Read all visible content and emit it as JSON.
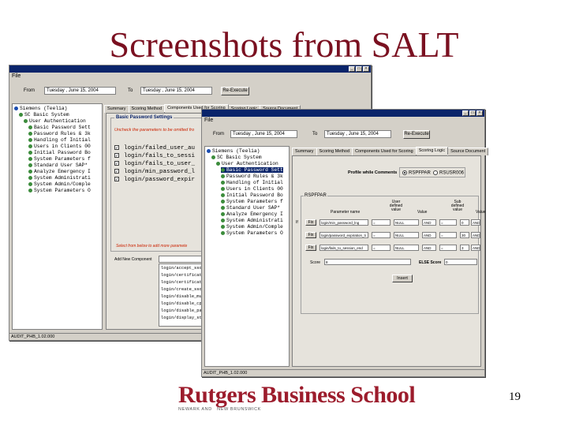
{
  "slide": {
    "title": "Screenshots from SALT",
    "page_number": "19",
    "logo_text": "Rutgers Business School",
    "logo_sub_left": "NEWARK AND",
    "logo_sub_right": "NEW BRUNSWICK"
  },
  "window1": {
    "menu": "File",
    "from_label": "From",
    "from_value": "Tuesday ,   June   15, 2004",
    "to_label": "To",
    "to_value": "Tuesday ,   June   15, 2004",
    "reexecute": "Re-Execute",
    "tree": [
      "Siemens (Teelia)",
      "SC Basic System",
      "User Authentication",
      "Basic Password Sett",
      "Password Rules & 3k",
      "Handling of Initial",
      "Users in Clients 00",
      "Initial Password Bo",
      "System Parameters f",
      "Standard User SAP*",
      "Analyze Emergency I",
      "System Administrati",
      "System Admin/Comple",
      "System Parameters O"
    ],
    "tabs": [
      "Summary",
      "Scoring Method",
      "Components Used for Scoring",
      "Scoring Logic",
      "Source Document"
    ],
    "group_label": "Basic Password Settings",
    "instruction": "Uncheck the parameters to be omitted fro",
    "params": [
      "login/failed_user_au",
      "login/fails_to_sessi",
      "login/fails_to_user_",
      "login/min_password_l",
      "login/password_expir"
    ],
    "select_hint": "Select from below to add more paramete",
    "add_label": "Add New Component",
    "list": [
      "login/accept_sso2_",
      "login/certificate_r",
      "login/certificate_r",
      "login/create_sso2_",
      "login/disable_mult",
      "login/disable_cpic",
      "login/disable_pass",
      "login/display_state"
    ],
    "status": "AUDIT_PHB_1.02.000"
  },
  "window2": {
    "menu": "File",
    "from_label": "From",
    "from_value": "Tuesday ,   June   15, 2004",
    "to_label": "To",
    "to_value": "Tuesday ,   June   15, 2004",
    "reexecute": "Re-Execute",
    "tree": [
      "Siemens (Teelia)",
      "SC Basic System",
      "User Authentication",
      "Basic Password Sett",
      "Password Rules & 3k",
      "Handling of Initial",
      "Users in Clients 00",
      "Initial Password Bo",
      "System Parameters f",
      "Standard User SAP*",
      "Analyze Emergency I",
      "System Administrati",
      "System Admin/Comple",
      "System Parameters O"
    ],
    "tabs": [
      "Summary",
      "Scoring Method",
      "Components Used for Scoring",
      "Scoring Logic",
      "Source Document"
    ],
    "profile_label": "Profile while Comments",
    "radio_a": "RSPFPAR",
    "radio_b": "RSUSR006",
    "group_label": "RSPFPAR",
    "headers": {
      "param": "Parameter name",
      "user_defined": "User defined value",
      "value1": "Value",
      "sub_defined": "Sub defined value",
      "value2": "Value"
    },
    "rows": [
      {
        "prefix": "If",
        "fix": "Fix",
        "name": "login/min_password_lng",
        "op": "=",
        "v1": "NULL",
        "logic": "AND",
        "op2": "=",
        "v2": "0",
        "logic2": "AND"
      },
      {
        "prefix": "",
        "fix": "Fix",
        "name": "login/password_expiration_ti",
        "op": "=",
        "v1": "NULL",
        "logic": "AND",
        "op2": "=",
        "v2": "30",
        "logic2": "AND"
      },
      {
        "prefix": "",
        "fix": "Fix",
        "name": "login/fails_to_session_end",
        "op": "=",
        "v1": "NULL",
        "logic": "AND",
        "op2": "=",
        "v2": "3",
        "logic2": "AND"
      }
    ],
    "score_label": "Score",
    "score_value": "8",
    "else_label": "ELSE Score",
    "else_value": "0",
    "insert": "Insert",
    "status": "AUDIT_PHB_1.02.000"
  },
  "colors": {
    "title": "#7a1020",
    "logo": "#9c1c2c",
    "window_bg": "#d4d0c8",
    "titlebar": "#0a246a",
    "instruction": "#cc2200"
  }
}
